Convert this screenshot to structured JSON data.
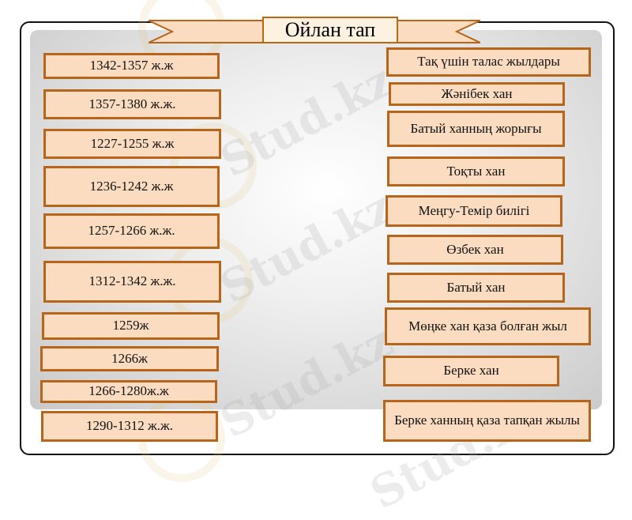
{
  "title": "Ойлан тап",
  "left_items": [
    "1342-1357 ж.ж",
    "1357-1380 ж.ж.",
    "1227-1255 ж.ж",
    "1236-1242 ж.ж",
    "1257-1266 ж.ж.",
    "1312-1342 ж.ж.",
    "1259ж",
    "1266ж",
    "1266-1280ж.ж",
    "1290-1312 ж.ж."
  ],
  "right_items": [
    "Тақ үшін талас жылдары",
    "Жәнібек хан",
    "Батый ханның жорығы",
    "Тоқты хан",
    "Меңгу-Темір билігі",
    "Өзбек хан",
    "Батый хан",
    "Мөңке хан қаза болған жыл",
    "Берке хан",
    "Берке ханның қаза тапқан жылы"
  ],
  "watermark": "Stud.kz"
}
